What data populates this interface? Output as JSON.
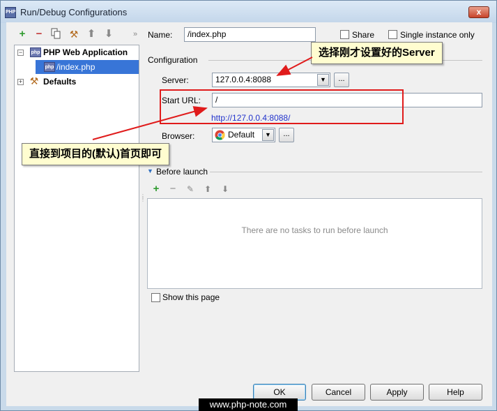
{
  "window": {
    "title": "Run/Debug Configurations",
    "icon": "php-run-icon",
    "close_label": "x"
  },
  "left_toolbar": {
    "icons": [
      "add-icon",
      "remove-icon",
      "copy-icon",
      "edit-defaults-icon",
      "move-up-icon",
      "move-down-icon",
      "more-icon"
    ],
    "more_label": "»"
  },
  "tree": {
    "group_label": "PHP Web Application",
    "child_label": "/index.php",
    "defaults_label": "Defaults"
  },
  "form": {
    "name_label": "Name:",
    "name_value": "/index.php",
    "share_label": "Share",
    "single_instance_label": "Single instance only",
    "configuration_label": "Configuration",
    "server_label": "Server:",
    "server_value": "127.0.0.4:8088",
    "start_url_label": "Start URL:",
    "start_url_value": "/",
    "full_url": "http://127.0.0.4:8088/",
    "browser_label": "Browser:",
    "browser_value": "Default",
    "ellipsis": "...",
    "before_launch_label": "Before launch",
    "no_tasks_text": "There are no tasks to run before launch",
    "show_page_label": "Show this page"
  },
  "buttons": {
    "ok": "OK",
    "cancel": "Cancel",
    "apply": "Apply",
    "help": "Help"
  },
  "annotations": {
    "server_note": "选择刚才设置好的Server",
    "url_note": "直接到项目的(默认)首页即可",
    "color": "#e01b1b"
  },
  "watermark": "www.php-note.com"
}
